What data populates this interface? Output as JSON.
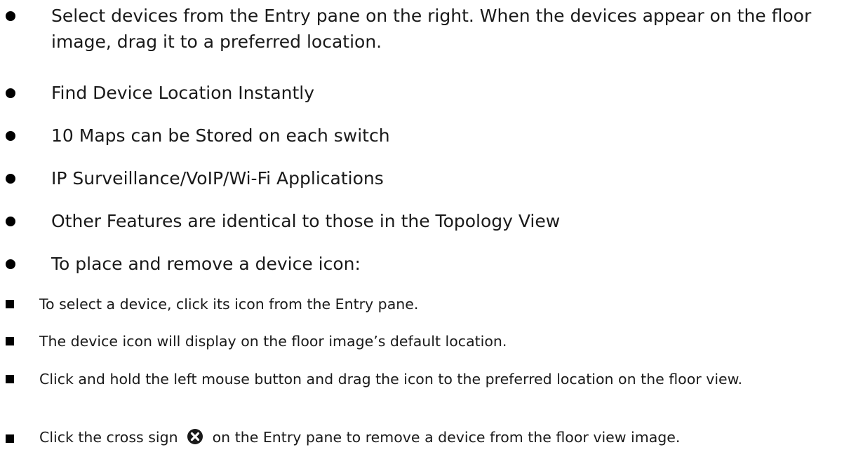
{
  "bullets": [
    {
      "text": "Select devices from the Entry pane on the right. When the devices appear on the floor image, drag it to a preferred location."
    },
    {
      "text": "Find Device Location Instantly"
    },
    {
      "text": "10 Maps can be Stored on each switch"
    },
    {
      "text": "IP Surveillance/VoIP/Wi-Fi Applications"
    },
    {
      "text": "Other Features are identical to those in the Topology View"
    },
    {
      "text": "To place and remove a device icon:"
    }
  ],
  "sub_bullets": [
    {
      "text": "To select a device, click its icon from the Entry pane."
    },
    {
      "text": "The device icon will display on the floor image’s default location."
    },
    {
      "text": "Click and hold the left mouse button and drag the icon to the preferred location on the floor view."
    },
    {
      "text_before": "Click the cross sign",
      "icon": "circle-x-icon",
      "text_after": "on the Entry pane to remove a device from the floor view image."
    }
  ]
}
